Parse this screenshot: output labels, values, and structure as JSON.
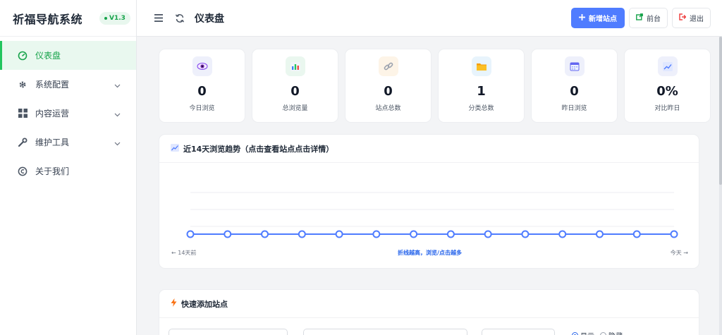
{
  "app": {
    "title": "祈福导航系统",
    "version": "V1.3"
  },
  "sidebar": {
    "items": [
      {
        "label": "仪表盘",
        "icon": "dashboard-icon",
        "active": true
      },
      {
        "label": "系统配置",
        "icon": "gear-icon",
        "expandable": true
      },
      {
        "label": "内容运营",
        "icon": "grid-icon",
        "expandable": true
      },
      {
        "label": "维护工具",
        "icon": "wrench-icon",
        "expandable": true
      },
      {
        "label": "关于我们",
        "icon": "copyright-icon"
      }
    ]
  },
  "header": {
    "title": "仪表盘",
    "add_site_label": "新增站点",
    "frontend_label": "前台",
    "logout_label": "退出"
  },
  "stats": [
    {
      "value": "0",
      "label": "今日浏览",
      "icon": "eye-icon"
    },
    {
      "value": "0",
      "label": "总浏览量",
      "icon": "bar-chart-icon"
    },
    {
      "value": "0",
      "label": "站点总数",
      "icon": "link-icon"
    },
    {
      "value": "1",
      "label": "分类总数",
      "icon": "folder-icon"
    },
    {
      "value": "0",
      "label": "昨日浏览",
      "icon": "calendar-icon"
    },
    {
      "value": "0%",
      "label": "对比昨日",
      "icon": "trend-icon"
    }
  ],
  "trend": {
    "title": "近14天浏览趋势（点击查看站点点击详情）",
    "left_label": "← 14天前",
    "mid_label": "折线越高，浏览/点击越多",
    "right_label": "今天 →"
  },
  "chart_data": {
    "type": "line",
    "title": "近14天浏览趋势（点击查看站点点击详情）",
    "x": [
      1,
      2,
      3,
      4,
      5,
      6,
      7,
      8,
      9,
      10,
      11,
      12,
      13,
      14
    ],
    "series": [
      {
        "values": [
          0,
          0,
          0,
          0,
          0,
          0,
          0,
          0,
          0,
          0,
          0,
          0,
          0,
          0
        ]
      }
    ],
    "grid": true,
    "line_color": "#4f7cff"
  },
  "quick_add": {
    "title": "快速添加站点",
    "radio_show": "显示",
    "radio_hide": "隐藏"
  },
  "colors": {
    "accent": "#4f7cff",
    "success": "#22c55e",
    "danger": "#ef4444"
  }
}
